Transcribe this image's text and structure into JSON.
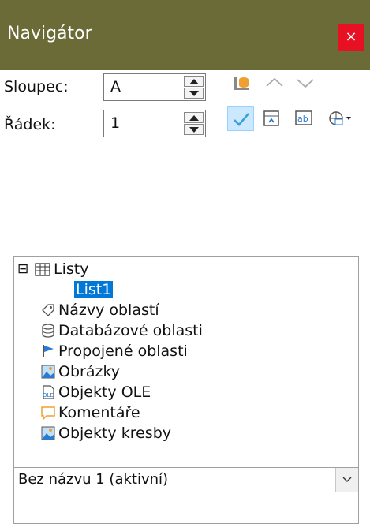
{
  "window": {
    "title": "Navigátor",
    "close_label": "×"
  },
  "fields": {
    "column_label": "Sloupec:",
    "column_value": "A",
    "row_label": "Řádek:",
    "row_value": "1"
  },
  "toolbar": {
    "icons": [
      "data-range-icon",
      "previous-icon",
      "next-icon",
      "toggle-icon",
      "scenarios-icon",
      "contents-icon",
      "drag-mode-icon"
    ],
    "active": "toggle-icon"
  },
  "tree": {
    "root_expander": "⊟",
    "items": [
      {
        "label": "Listy",
        "icon": "sheets-icon"
      },
      {
        "label": "List1",
        "icon": ""
      },
      {
        "label": "Názvy oblastí",
        "icon": "range-names-icon"
      },
      {
        "label": "Databázové oblasti",
        "icon": "database-icon"
      },
      {
        "label": "Propojené oblasti",
        "icon": "linked-areas-icon"
      },
      {
        "label": "Obrázky",
        "icon": "image-icon"
      },
      {
        "label": "Objekty OLE",
        "icon": "ole-icon"
      },
      {
        "label": "Komentáře",
        "icon": "comment-icon"
      },
      {
        "label": "Objekty kresby",
        "icon": "drawing-icon"
      }
    ]
  },
  "document_select": {
    "value": "Bez názvu 1 (aktivní)"
  },
  "colors": {
    "titlebar": "#6b6b37",
    "close": "#e81123",
    "selection": "#0078d7",
    "accent": "#f0a030"
  }
}
